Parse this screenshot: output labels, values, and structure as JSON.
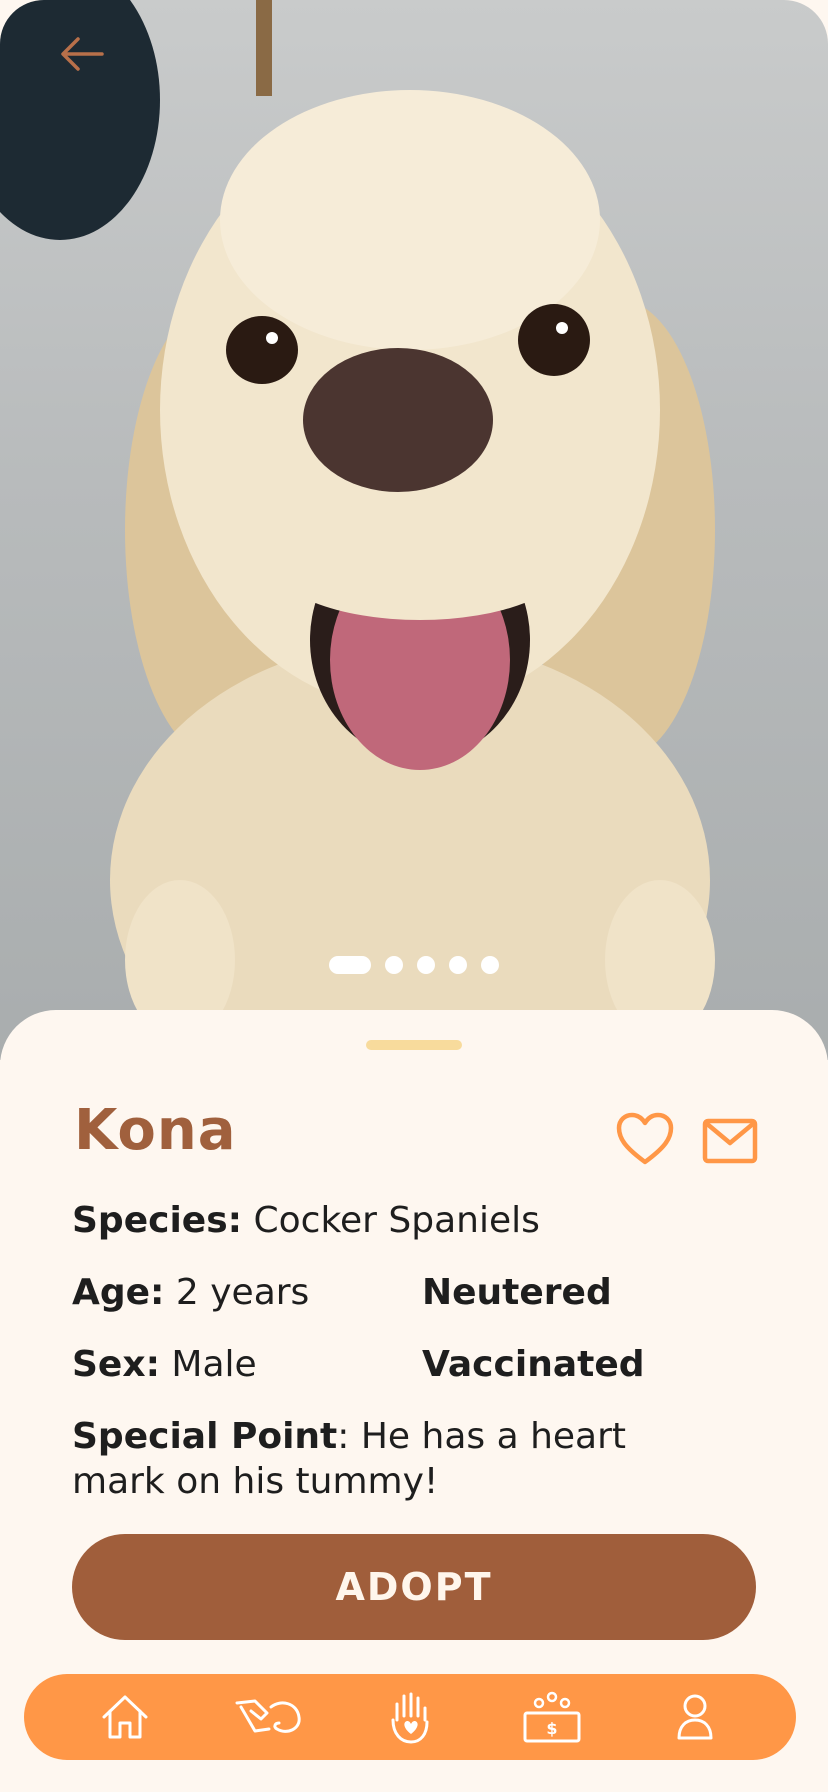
{
  "pet": {
    "name": "Kona",
    "species_label": "Species:",
    "species_value": " Cocker Spaniels",
    "age_label": "Age:",
    "age_value": " 2 years",
    "sex_label": "Sex:",
    "sex_value": " Male",
    "status_1": "Neutered",
    "status_2": "Vaccinated",
    "special_label": "Special Point",
    "special_value": ": He has a heart mark on his tummy!"
  },
  "gallery": {
    "total_images": 5,
    "active_index": 0
  },
  "actions": {
    "adopt_label": "ADOPT"
  },
  "icons": {
    "back": "arrow-left-icon",
    "favorite": "heart-icon",
    "message": "mail-icon",
    "nav": [
      "home-icon",
      "pet-hand-icon",
      "volunteer-hand-icon",
      "donate-icon",
      "profile-icon"
    ]
  },
  "colors": {
    "accent": "#FF9747",
    "brown": "#A05E3B",
    "name": "#A0603D",
    "background": "#FEF7F0",
    "handle": "#F8DB9C"
  }
}
